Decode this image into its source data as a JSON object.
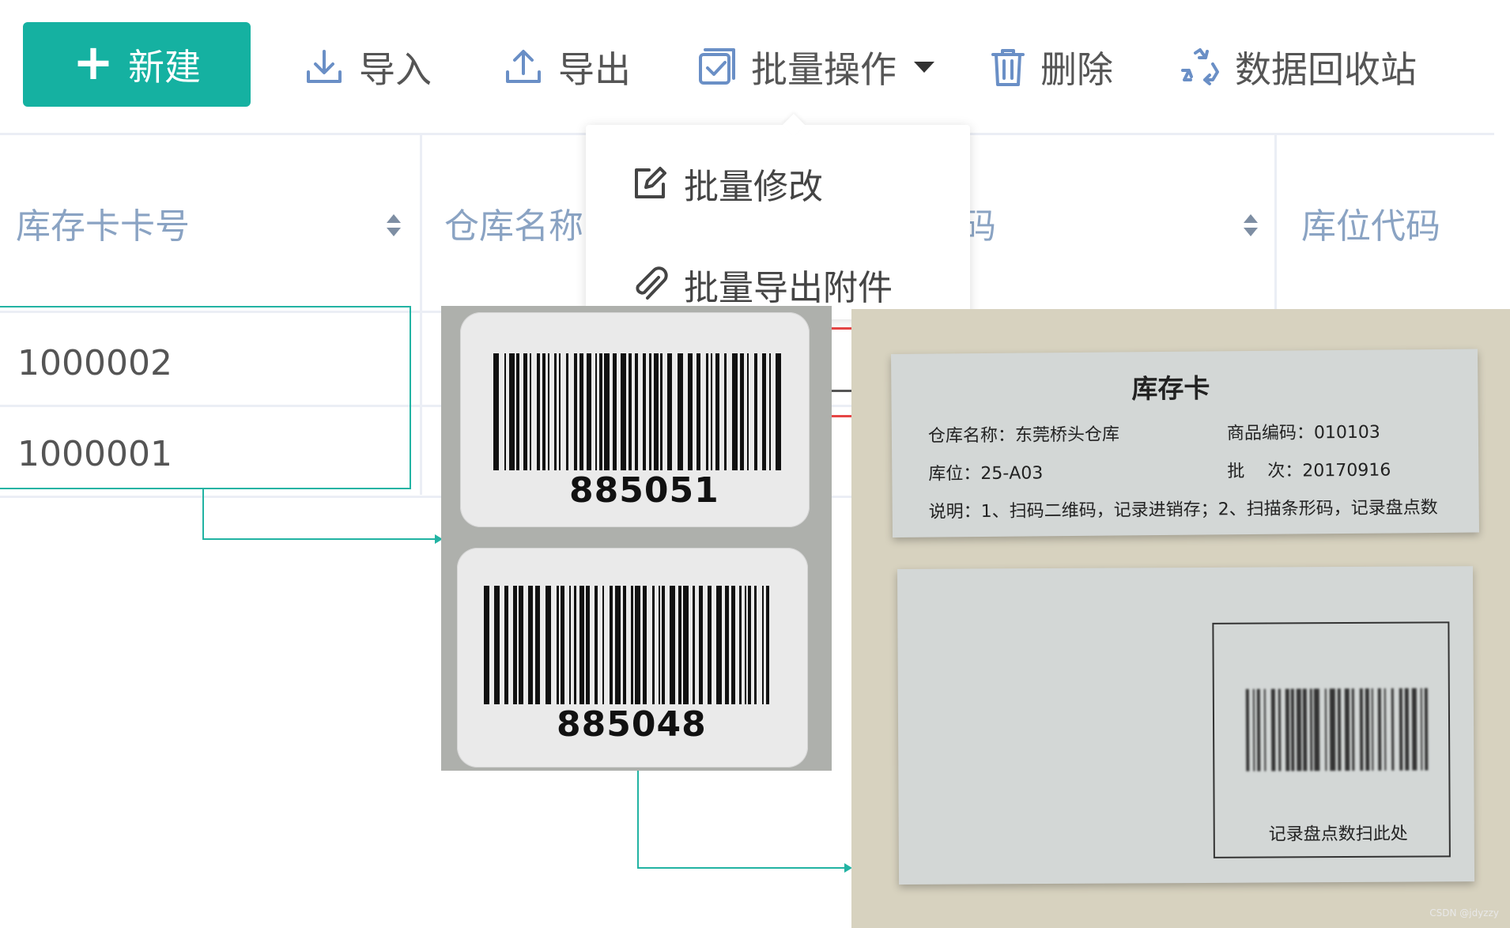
{
  "toolbar": {
    "new_label": "新建",
    "import_label": "导入",
    "export_label": "导出",
    "batch_label": "批量操作",
    "delete_label": "删除",
    "recycle_label": "数据回收站"
  },
  "dropdown": {
    "items": [
      {
        "label": "批量修改",
        "icon": "edit-icon"
      },
      {
        "label": "批量导出附件",
        "icon": "paperclip-icon"
      }
    ]
  },
  "table": {
    "columns": [
      "库存卡卡号",
      "仓库名称",
      "码",
      "库位代码"
    ],
    "rows": [
      {
        "card_no": "1000002"
      },
      {
        "card_no": "1000001"
      }
    ]
  },
  "barcode_labels": [
    "885051",
    "885048"
  ],
  "stock_card": {
    "title": "库存卡",
    "warehouse": "仓库名称：东莞桥头仓库",
    "product_code": "商品编码：010103",
    "location": "库位：25-A03",
    "batch": "批　 次：20170916",
    "note": "说明：1、扫码二维码，记录进销存；2、扫描条形码，记录盘点数",
    "scan_hint": "记录盘点数扫此处"
  },
  "watermark": "CSDN @jdyzzy",
  "colors": {
    "accent": "#15b1a1",
    "icon_blue": "#6a8fc6",
    "header_text": "#8aa3c3",
    "highlight": "#22b3a3"
  }
}
